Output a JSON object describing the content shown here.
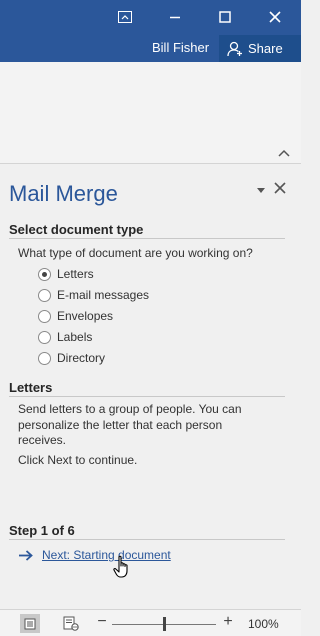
{
  "titlebar": {
    "user_name": "Bill Fisher",
    "share_label": "Share",
    "icons": [
      "ribbon-display-options-icon",
      "minimize-icon",
      "maximize-icon",
      "close-icon",
      "person-icon"
    ]
  },
  "ribbon": {
    "collapse_icon": "chevron-up-icon"
  },
  "pane": {
    "title": "Mail Merge",
    "section1": {
      "heading": "Select document type",
      "question": "What type of document are you working on?",
      "options": [
        "Letters",
        "E-mail messages",
        "Envelopes",
        "Labels",
        "Directory"
      ],
      "selected": "Letters"
    },
    "section2": {
      "heading": "Letters",
      "description_line1": "Send letters to a group of people. You can",
      "description_line2": "personalize the letter that each person",
      "description_line3": "receives.",
      "instruction": "Click Next to continue."
    },
    "step": {
      "heading": "Step 1 of 6",
      "next_label": "Next: Starting document"
    }
  },
  "statusbar": {
    "zoom_minus": "−",
    "zoom_plus": "+",
    "zoom_level": "100%",
    "zoom_fraction": 0.5
  },
  "colors": {
    "titlebar": "#2b579a",
    "accent": "#2b579a",
    "pane_background": "#f0f0f0"
  }
}
